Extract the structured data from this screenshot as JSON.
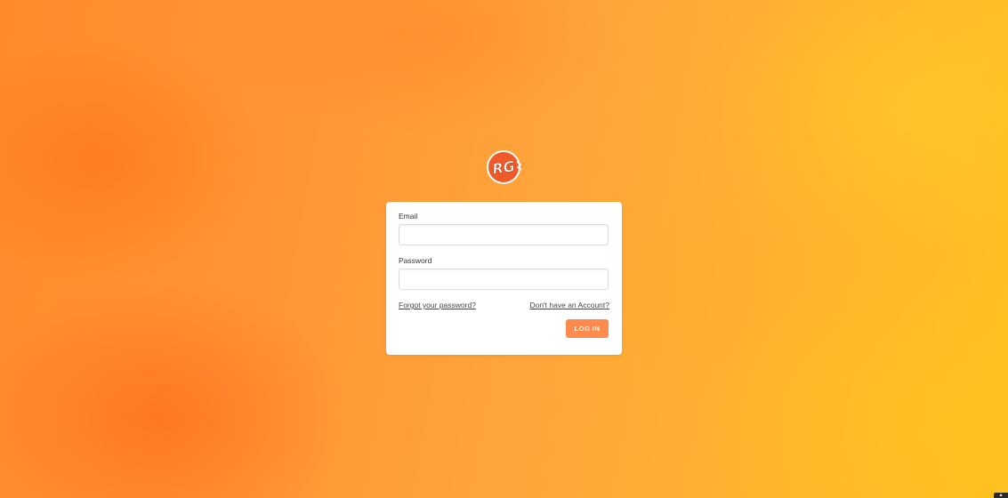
{
  "logo": {
    "text": "RG",
    "accent_color": "#f05a28"
  },
  "login_form": {
    "email_label": "Email",
    "email_value": "",
    "email_placeholder": "",
    "password_label": "Password",
    "password_value": "",
    "password_placeholder": "",
    "forgot_password_link": "Forgot your password?",
    "signup_link": "Don't have an Account?",
    "login_button": "LOG IN",
    "button_color": "#ff8a4e"
  },
  "background": {
    "style": "orange watercolor",
    "colors": [
      "#ff8a2c",
      "#ffa53a",
      "#ffc11f"
    ]
  }
}
